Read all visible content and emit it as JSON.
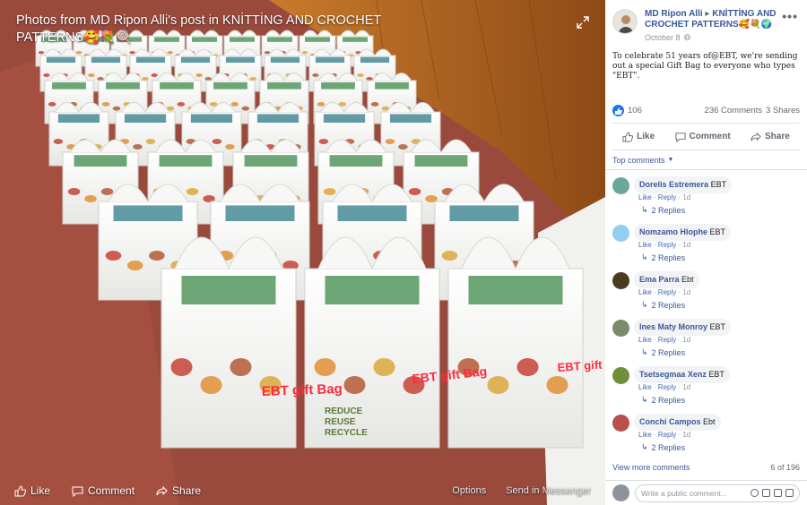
{
  "photo": {
    "title": "Photos from MD Ripon Alli's post in KNİTTİNG AND CROCHET PATTERNS🥰💐🍭",
    "bag_caption": "EBT gift Bag",
    "bag_print": [
      "REDUCE",
      "REUSE",
      "RECYCLE"
    ],
    "bar": {
      "like": "Like",
      "comment": "Comment",
      "share": "Share",
      "options": "Options",
      "send": "Send in Messenger"
    }
  },
  "post": {
    "author": "MD Ripon Alli",
    "group": "KNİTTİNG AND CROCHET PATTERNS🥰💐🌍",
    "date": "October 8",
    "text": "To celebrate 51 years of@EBT, we're sending out a special Gift Bag to everyone who types \"EBT\".",
    "likes": "106",
    "comments_count": "236 Comments",
    "shares_count": "3 Shares",
    "actions": {
      "like": "Like",
      "comment": "Comment",
      "share": "Share"
    },
    "top_comments": "Top comments"
  },
  "comments": [
    {
      "name": "Dorelis Estremera",
      "text": "EBT",
      "like": "Like",
      "reply": "Reply",
      "time": "1d",
      "replies": "2 Replies",
      "color": "#6aa99a"
    },
    {
      "name": "Nomzamo Hlophe",
      "text": "EBT",
      "like": "Like",
      "reply": "Reply",
      "time": "1d",
      "replies": "2 Replies",
      "color": "#8fd0f0"
    },
    {
      "name": "Ema Parra",
      "text": "Ebt",
      "like": "Like",
      "reply": "Reply",
      "time": "1d",
      "replies": "2 Replies",
      "color": "#4b3a1e"
    },
    {
      "name": "Ines Maty Monroy",
      "text": "EBT",
      "like": "Like",
      "reply": "Reply",
      "time": "1d",
      "replies": "2 Replies",
      "color": "#7a8a6a"
    },
    {
      "name": "Tsetsegmaa Xenz",
      "text": "EBT",
      "like": "Like",
      "reply": "Reply",
      "time": "1d",
      "replies": "2 Replies",
      "color": "#6f8f3a"
    },
    {
      "name": "Conchi Campos",
      "text": "Ebt",
      "like": "Like",
      "reply": "Reply",
      "time": "1d",
      "replies": "2 Replies",
      "color": "#b85050"
    }
  ],
  "footer": {
    "view_more": "View more comments",
    "count": "6 of 196",
    "placeholder": "Write a public comment..."
  }
}
